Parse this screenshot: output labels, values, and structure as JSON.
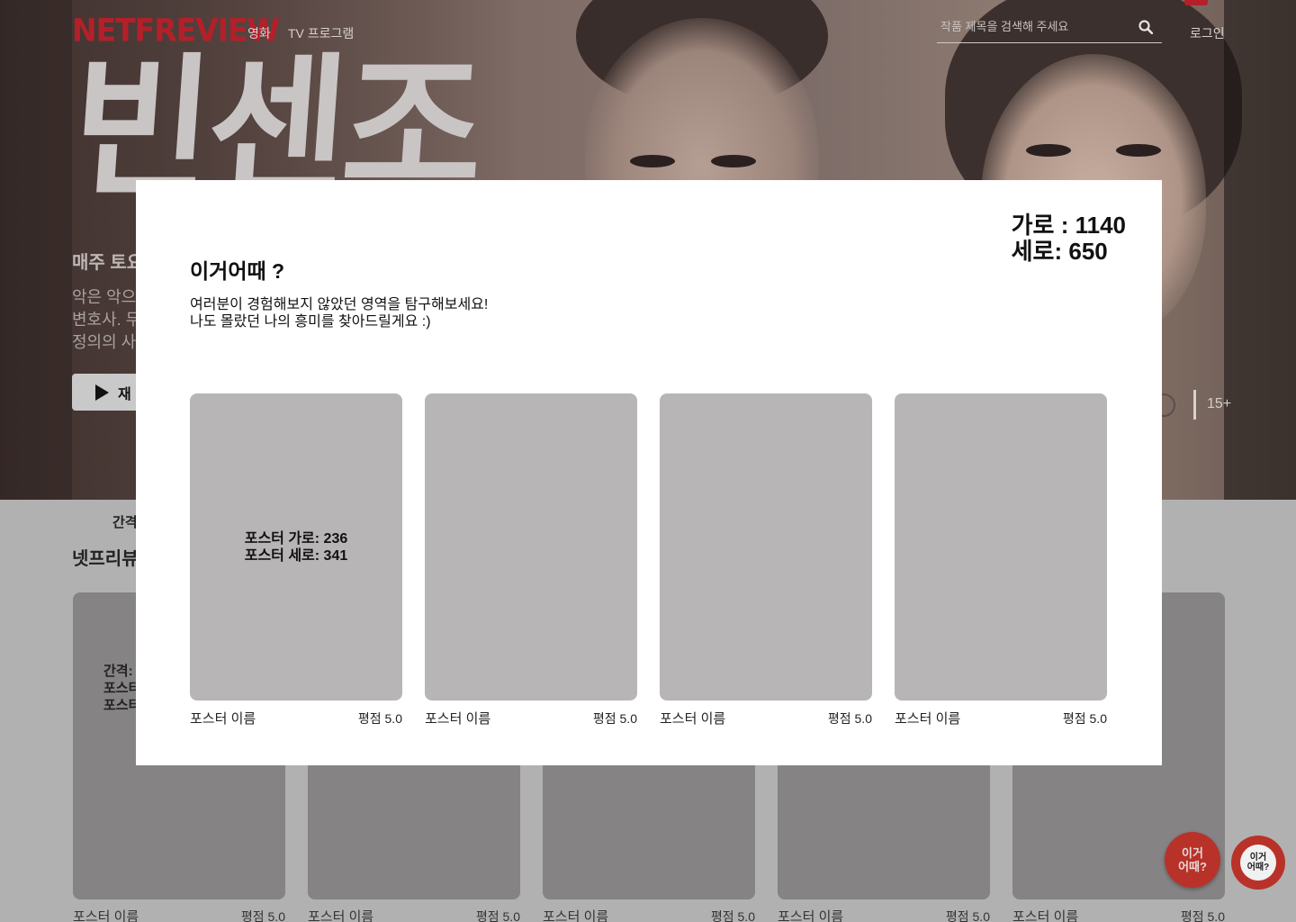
{
  "header": {
    "logo": "NETFREVIEW",
    "nav": [
      "영화",
      "TV 프로그램"
    ],
    "search_placeholder": "작품 제목을 검색해 주세요",
    "login": "로그인"
  },
  "hero": {
    "title": "빈센조",
    "tagline": "매주 토요",
    "description": [
      "악은 악으",
      "변호사. 무",
      "정의의 사"
    ],
    "play_label": "재",
    "age_rating": "15+"
  },
  "section": {
    "gap_label": "간격",
    "title": "넷프리뷰",
    "card_note": [
      "간격:",
      "포스터",
      "포스터"
    ],
    "cards": [
      {
        "name": "포스터 이름",
        "score": "평점 5.0"
      },
      {
        "name": "포스터 이름",
        "score": "평점 5.0"
      },
      {
        "name": "포스터 이름",
        "score": "평점 5.0"
      },
      {
        "name": "포스터 이름",
        "score": "평점 5.0"
      },
      {
        "name": "포스터 이름",
        "score": "평점 5.0"
      }
    ]
  },
  "fabs": {
    "primary": [
      "이거",
      "어때?"
    ],
    "secondary": [
      "이거",
      "어때?"
    ]
  },
  "modal": {
    "size_width": "가로 : 1140",
    "size_height": "세로: 650",
    "title": "이거어때 ?",
    "description": [
      "여러분이 경험해보지 않았던 영역을 탐구해보세요!",
      "나도 몰랐던 나의 흥미를 찾아드릴게요 :)"
    ],
    "poster_note": [
      "포스터 가로: 236",
      "포스터 세로: 341"
    ],
    "posters": [
      {
        "name": "포스터 이름",
        "score": "평점 5.0"
      },
      {
        "name": "포스터 이름",
        "score": "평점 5.0"
      },
      {
        "name": "포스터 이름",
        "score": "평점 5.0"
      },
      {
        "name": "포스터 이름",
        "score": "평점 5.0"
      }
    ]
  },
  "colors": {
    "brand": "#b3202a",
    "modal_bg": "#ffffff",
    "poster_placeholder": "#b8b5b6",
    "page_dim": "#b1b1b1"
  }
}
